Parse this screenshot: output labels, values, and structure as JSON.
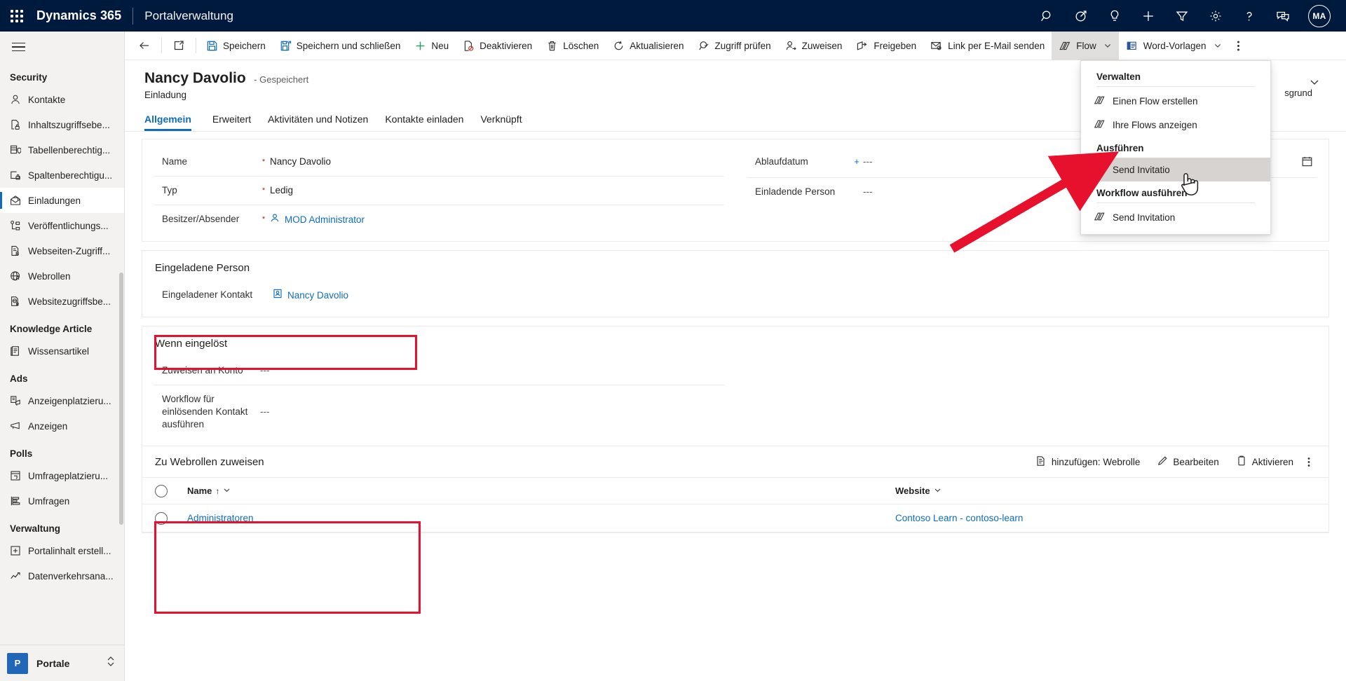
{
  "appbar": {
    "waffle_icon": "waffle-icon",
    "brand": "Dynamics 365",
    "app_name": "Portalverwaltung",
    "icons": [
      {
        "name": "search-icon",
        "label": "Suche"
      },
      {
        "name": "assistant-icon",
        "label": "Assistent"
      },
      {
        "name": "lightbulb-icon",
        "label": "Neuigkeiten"
      },
      {
        "name": "add-icon",
        "label": "Schnellerfassung"
      },
      {
        "name": "filter-icon",
        "label": "Filter"
      },
      {
        "name": "gear-icon",
        "label": "Einstellungen"
      },
      {
        "name": "help-icon",
        "label": "Hilfe"
      },
      {
        "name": "feedback-icon",
        "label": "Feedback"
      }
    ],
    "avatar_initials": "MA"
  },
  "sidebar": {
    "hamburger_icon": "hamburger-icon",
    "groups": [
      {
        "title": "Security",
        "items": [
          {
            "label": "Kontakte",
            "icon": "contact-icon",
            "active": false
          },
          {
            "label": "Inhaltszugriffsebe...",
            "icon": "content-access-icon",
            "active": false
          },
          {
            "label": "Tabellenberechtig...",
            "icon": "table-permission-icon",
            "active": false
          },
          {
            "label": "Spaltenberechtigu...",
            "icon": "column-permission-icon",
            "active": false
          },
          {
            "label": "Einladungen",
            "icon": "invitation-icon",
            "active": true
          },
          {
            "label": "Veröffentlichungs...",
            "icon": "publishing-state-icon",
            "active": false
          },
          {
            "label": "Webseiten-Zugriff...",
            "icon": "webpage-access-icon",
            "active": false
          },
          {
            "label": "Webrollen",
            "icon": "webrole-icon",
            "active": false
          },
          {
            "label": "Websitezugriffsbe...",
            "icon": "website-access-icon",
            "active": false
          }
        ]
      },
      {
        "title": "Knowledge Article",
        "items": [
          {
            "label": "Wissensartikel",
            "icon": "knowledge-article-icon",
            "active": false
          }
        ]
      },
      {
        "title": "Ads",
        "items": [
          {
            "label": "Anzeigenplatzieru...",
            "icon": "ad-placement-icon",
            "active": false
          },
          {
            "label": "Anzeigen",
            "icon": "ad-icon",
            "active": false
          }
        ]
      },
      {
        "title": "Polls",
        "items": [
          {
            "label": "Umfrageplatzieru...",
            "icon": "poll-placement-icon",
            "active": false
          },
          {
            "label": "Umfragen",
            "icon": "poll-icon",
            "active": false
          }
        ]
      },
      {
        "title": "Verwaltung",
        "items": [
          {
            "label": "Portalinhalt erstell...",
            "icon": "create-portal-content-icon",
            "active": false
          },
          {
            "label": "Datenverkehrsana...",
            "icon": "traffic-analysis-icon",
            "active": false
          }
        ]
      }
    ],
    "footer": {
      "tile_letter": "P",
      "label": "Portale",
      "switch_icon": "chevron-up-down-icon"
    }
  },
  "commandbar": {
    "back_icon": "back-arrow-icon",
    "popout_icon": "open-in-new-window-icon",
    "commands": [
      {
        "label": "Speichern",
        "icon": "save-icon"
      },
      {
        "label": "Speichern und schließen",
        "icon": "save-and-close-icon"
      },
      {
        "label": "Neu",
        "icon": "new-icon"
      },
      {
        "label": "Deaktivieren",
        "icon": "deactivate-icon"
      },
      {
        "label": "Löschen",
        "icon": "delete-icon"
      },
      {
        "label": "Aktualisieren",
        "icon": "refresh-icon"
      },
      {
        "label": "Zugriff prüfen",
        "icon": "check-access-icon"
      },
      {
        "label": "Zuweisen",
        "icon": "assign-icon"
      },
      {
        "label": "Freigeben",
        "icon": "share-icon"
      },
      {
        "label": "Link per E-Mail senden",
        "icon": "email-link-icon"
      },
      {
        "label": "Flow",
        "icon": "flow-icon",
        "has_chevron": true,
        "expanded": true
      },
      {
        "label": "Word-Vorlagen",
        "icon": "word-template-icon",
        "has_chevron": true
      }
    ],
    "overflow_icon": "more-commands-icon"
  },
  "flow_flyout": {
    "sections": [
      {
        "header": "Verwalten",
        "items": [
          {
            "label": "Einen Flow erstellen",
            "icon": "flow-icon",
            "highlighted": false
          },
          {
            "label": "Ihre Flows anzeigen",
            "icon": "flow-icon",
            "highlighted": false
          }
        ]
      },
      {
        "header": "Ausführen",
        "items": [
          {
            "label": "Send Invitatio",
            "icon": "flow-icon",
            "highlighted": true
          }
        ]
      },
      {
        "header": "Workflow ausführen",
        "items": [
          {
            "label": "Send Invitation",
            "icon": "flow-icon",
            "highlighted": false
          }
        ]
      }
    ]
  },
  "record": {
    "title": "Nancy Davolio",
    "state": "- Gespeichert",
    "entity": "Einladung",
    "header_side_label": "sgrund",
    "collapse_icon": "chevron-down-icon"
  },
  "tabs": [
    {
      "label": "Allgemein",
      "selected": true
    },
    {
      "label": "Erweitert",
      "selected": false
    },
    {
      "label": "Aktivitäten und Notizen",
      "selected": false
    },
    {
      "label": "Kontakte einladen",
      "selected": false
    },
    {
      "label": "Verknüpft",
      "selected": false
    }
  ],
  "main_section": {
    "left_fields": [
      {
        "label": "Name",
        "required": "*",
        "value": "Nancy Davolio",
        "kind": "text"
      },
      {
        "label": "Typ",
        "required": "*",
        "value": "Ledig",
        "kind": "text"
      },
      {
        "label": "Besitzer/Absender",
        "required": "*",
        "value": "MOD Administrator",
        "kind": "lookup-user"
      }
    ],
    "right_fields": [
      {
        "label": "Ablaufdatum",
        "required": "+",
        "value": "---",
        "kind": "date"
      },
      {
        "label": "Einladende Person",
        "required": "",
        "value": "---",
        "kind": "text"
      }
    ],
    "calendar_icon": "calendar-icon"
  },
  "invited_person_section": {
    "title": "Eingeladene Person",
    "fields": [
      {
        "label": "Eingeladener Kontakt",
        "value": "Nancy Davolio",
        "kind": "lookup-contact"
      }
    ]
  },
  "redeemed_section": {
    "title": "Wenn eingelöst",
    "fields": [
      {
        "label": "Zuweisen an Konto",
        "value": "---"
      },
      {
        "label": "Workflow für einlösenden Kontakt ausführen",
        "value": "---"
      }
    ]
  },
  "webroles_grid": {
    "title": "Zu Webrollen zuweisen",
    "actions": [
      {
        "label": "hinzufügen: Webrolle",
        "icon": "add-existing-icon"
      },
      {
        "label": "Bearbeiten",
        "icon": "edit-pencil-icon"
      },
      {
        "label": "Aktivieren",
        "icon": "activate-icon"
      }
    ],
    "overflow_icon": "more-commands-icon",
    "columns": [
      {
        "label": "Name",
        "sort": "↑",
        "chevron": "⌄"
      },
      {
        "label": "Website",
        "sort": "",
        "chevron": "⌄"
      }
    ],
    "rows": [
      {
        "name": "Administratoren",
        "website": "Contoso Learn - contoso-learn"
      }
    ]
  },
  "annotations": {
    "highlight_color": "#e8112d",
    "boxes": [
      {
        "name": "invited-contact-highlight"
      },
      {
        "name": "webroles-grid-highlight"
      }
    ],
    "arrow": {
      "name": "callout-arrow",
      "points_to": "Send Invitatio"
    },
    "cursor": {
      "name": "hand-cursor"
    }
  }
}
